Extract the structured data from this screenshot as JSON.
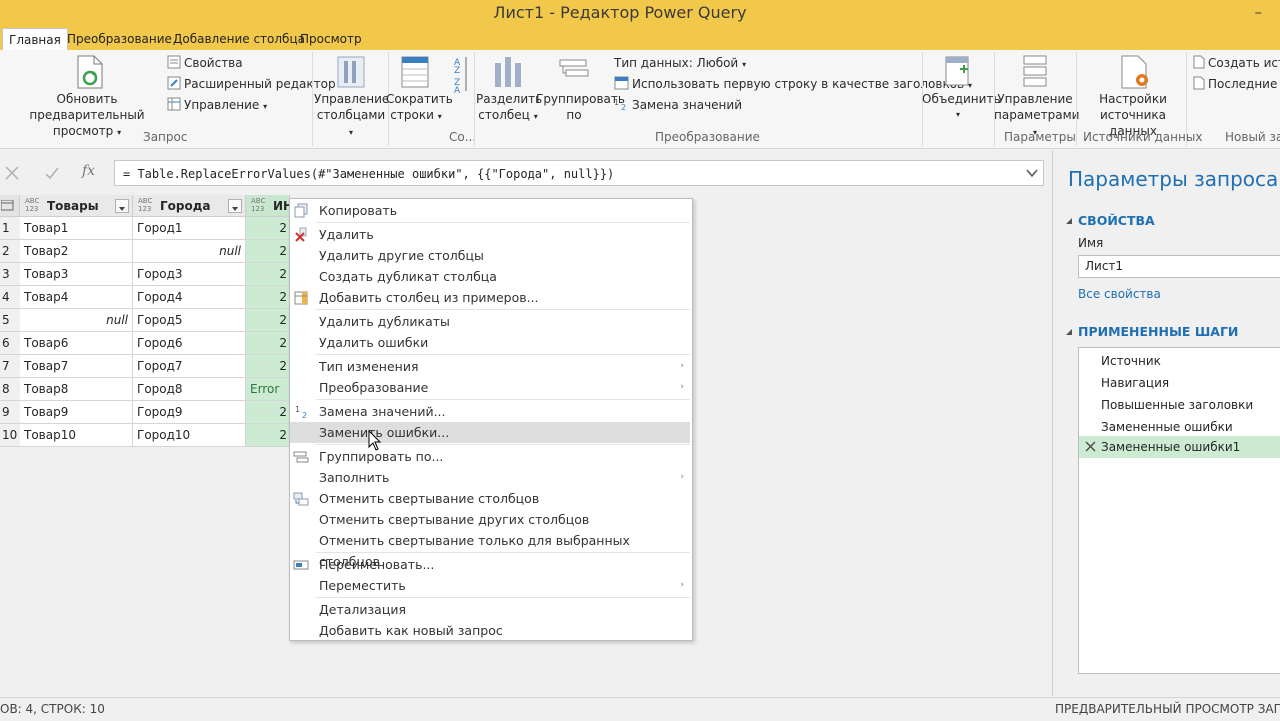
{
  "window": {
    "title": "Лист1 - Редактор Power Query",
    "minimize": "–"
  },
  "menu_tabs": [
    "Главная",
    "Преобразование",
    "Добавление столбца",
    "Просмотр"
  ],
  "ribbon": {
    "refresh_line1": "Обновить предварительный",
    "refresh_line2": "просмотр",
    "properties": "Свойства",
    "advanced_editor": "Расширенный редактор",
    "manage": "Управление",
    "group_query": "Запрос",
    "manage_columns_1": "Управление",
    "manage_columns_2": "столбцами",
    "reduce_rows_1": "Сократить",
    "reduce_rows_2": "строки",
    "group_sort": "Со...",
    "split_1": "Разделить",
    "split_2": "столбец",
    "group_by_1": "Группировать",
    "group_by_2": "по",
    "data_type": "Тип данных: Любой",
    "first_row_header": "Использовать первую строку в качестве заголовков",
    "replace_values": "Замена значений",
    "group_transform": "Преобразование",
    "combine": "Объединить",
    "manage_params_1": "Управление",
    "manage_params_2": "параметрами",
    "group_params": "Параметры",
    "ds_settings_1": "Настройки",
    "ds_settings_2": "источника данных",
    "group_sources": "Источники данных",
    "new_source": "Создать источ",
    "recent_sources": "Последние ис",
    "group_new_query": "Новый запр"
  },
  "formula": {
    "text": "= Table.ReplaceErrorValues(#\"Замененные ошибки\", {{\"Города\", null}})",
    "fx": "fx"
  },
  "table": {
    "headers": [
      "Товары",
      "Города",
      "ИН"
    ],
    "type_badge_top": "ABC",
    "type_badge_bottom": "123",
    "rows": [
      {
        "n": "1",
        "a": "Товар1",
        "b": "Город1",
        "c": "2"
      },
      {
        "n": "2",
        "a": "Товар2",
        "b": "null",
        "c": "2"
      },
      {
        "n": "3",
        "a": "Товар3",
        "b": "Город3",
        "c": "2"
      },
      {
        "n": "4",
        "a": "Товар4",
        "b": "Город4",
        "c": "2"
      },
      {
        "n": "5",
        "a": "null",
        "b": "Город5",
        "c": "2"
      },
      {
        "n": "6",
        "a": "Товар6",
        "b": "Город6",
        "c": "2"
      },
      {
        "n": "7",
        "a": "Товар7",
        "b": "Город7",
        "c": "2"
      },
      {
        "n": "8",
        "a": "Товар8",
        "b": "Город8",
        "c": "Error"
      },
      {
        "n": "9",
        "a": "Товар9",
        "b": "Город9",
        "c": "2"
      },
      {
        "n": "10",
        "a": "Товар10",
        "b": "Город10",
        "c": "2"
      }
    ]
  },
  "context_menu": {
    "items": [
      "Копировать",
      "Удалить",
      "Удалить другие столбцы",
      "Создать дубликат столбца",
      "Добавить столбец из примеров...",
      "Удалить дубликаты",
      "Удалить ошибки",
      "Тип изменения",
      "Преобразование",
      "Замена значений...",
      "Заменить ошибки...",
      "Группировать по...",
      "Заполнить",
      "Отменить свертывание столбцов",
      "Отменить свертывание других столбцов",
      "Отменить свертывание только для выбранных столбцов",
      "Переименовать...",
      "Переместить",
      "Детализация",
      "Добавить как новый запрос"
    ],
    "arrow": "›"
  },
  "right_pane": {
    "title": "Параметры запроса",
    "properties_header": "СВОЙСТВА",
    "name_label": "Имя",
    "name_value": "Лист1",
    "all_properties": "Все свойства",
    "steps_header": "ПРИМЕНЕННЫЕ ШАГИ",
    "steps": [
      "Источник",
      "Навигация",
      "Повышенные заголовки",
      "Замененные ошибки",
      "Замененные ошибки1"
    ]
  },
  "status": {
    "left": "ОВ: 4, СТРОК: 10",
    "right": "ПРЕДВАРИТЕЛЬНЫЙ ПРОСМОТР ЗАГРУЖ"
  },
  "colors": {
    "titlebar": "#f2c84a",
    "selected_column": "#cdebd3",
    "accent_blue": "#1f6fb2",
    "step_selected": "#cdebd3"
  }
}
